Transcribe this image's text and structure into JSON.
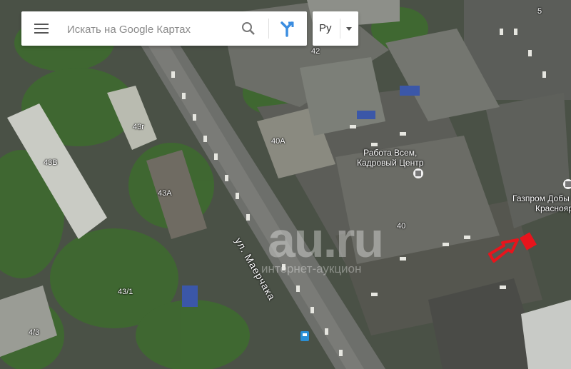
{
  "search": {
    "placeholder": "Искать на Google Картах"
  },
  "language": {
    "selected": "Ру"
  },
  "labels": {
    "b42": "42",
    "b5": "5",
    "b43g": "43г",
    "b43v": "43В",
    "b43a": "43А",
    "b40a": "40А",
    "b40": "40",
    "b43_1": "43/1",
    "b4_3": "4/3"
  },
  "street": "ул. Маерчака",
  "poi": {
    "rabota_line1": "Работа Всем,",
    "rabota_line2": "Кадровый Центр",
    "gazprom_line1": "Газпром Добы",
    "gazprom_line2": "Красноярс"
  },
  "watermark": {
    "main": "au.ru",
    "sub": "интернет-аукцион"
  },
  "colors": {
    "marker": "#e8141c",
    "arrow": "#e8141c",
    "poi_icon": "#ffffff"
  }
}
